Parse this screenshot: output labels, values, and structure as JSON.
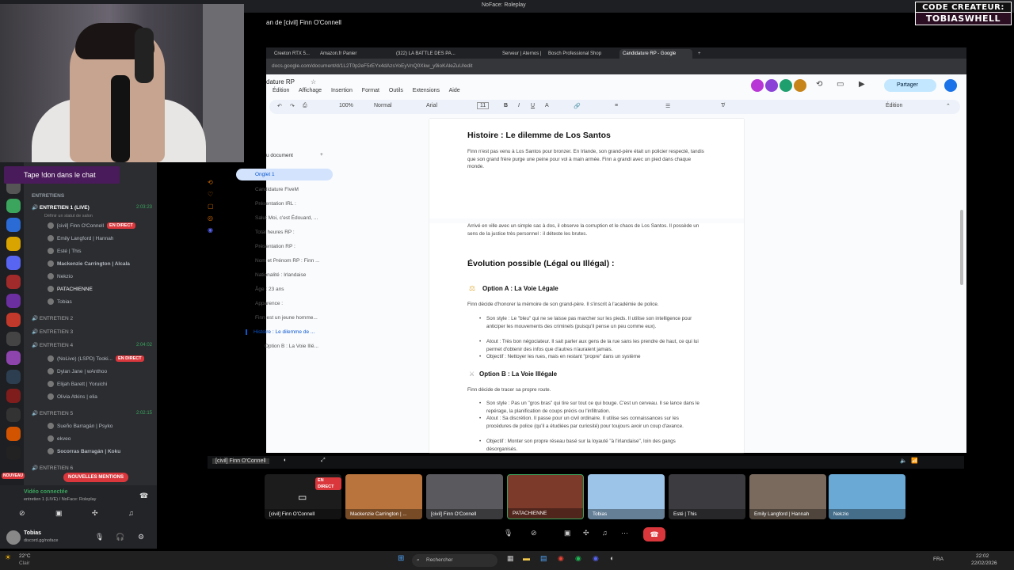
{
  "window": {
    "title": "NoFace: Roleplay"
  },
  "stream": {
    "title": "an de [civil] Finn O'Connell"
  },
  "badge": {
    "line1": "CODE CREATEUR:",
    "line2": "TOBIASWHELL"
  },
  "chat_banner": "Tape !don dans le chat",
  "channels": {
    "category": "ENTRETIENS",
    "live_label": "EN DIRECT",
    "items": [
      {
        "name": "ENTRETIEN 1 (LIVE)",
        "status": "Définir un statut de salon",
        "timer": "2:03:23",
        "users": [
          "[civil] Finn O'Connell",
          "Emily Langford | Hannah",
          "Esté | This",
          "Mackenzie Carrington | Alcala",
          "Nekzio",
          "PATACHIENNE",
          "Tobias"
        ]
      },
      {
        "name": "ENTRETIEN 2"
      },
      {
        "name": "ENTRETIEN 3"
      },
      {
        "name": "ENTRETIEN 4",
        "timer": "2:04:02",
        "users": [
          "(NoLive) (LSPD) Tooki...",
          "Dylan Jane | wAnthoo",
          "Elijah Barett | Yoruichi",
          "Olivia Atkins | elia"
        ]
      },
      {
        "name": "ENTRETIEN 5",
        "timer": "2:02:15",
        "users": [
          "Sueño Barragán | Psyko",
          "ekveo",
          "Socorras Barragán | Koku"
        ]
      },
      {
        "name": "ENTRETIEN 6"
      }
    ],
    "mentions_badge": "NOUVELLES MENTIONS",
    "new_badge": "NOUVEAU"
  },
  "voice_panel": {
    "status": "Vidéo connectée",
    "channel": "entretien 1 (LIVE) / NoFace: Roleplay"
  },
  "user_panel": {
    "name": "Tobias",
    "sub": "discord.gg/noface"
  },
  "browser": {
    "tabs": [
      "Creeton RTX 5...",
      "Amazon.fr Panier",
      "(322) LA BATTLE DES PA...",
      "Serveur | Aternos | Serve...",
      "Bosch Professional Shop",
      "Candidature RP - Google"
    ],
    "url": "docs.google.com/document/d/1L2T0p2eF5rEYx4dAzsYoEyVnQ0Xkw_y9ioKAleZuU/edit"
  },
  "docs": {
    "title": "dature RP",
    "menu": [
      "Édition",
      "Affichage",
      "Insertion",
      "Format",
      "Outils",
      "Extensions",
      "Aide"
    ],
    "share": "Partager",
    "mode": "Édition",
    "toolbar": {
      "zoom": "100%",
      "style": "Normal",
      "font": "Arial",
      "size": "11"
    }
  },
  "outline": {
    "header": "u document",
    "tab": "Onglet 1",
    "items": [
      "Candidature FiveM",
      "Présentation IRL :",
      "Salut Moi, c'est Édouard, ...",
      "Total heures RP :",
      "Présentation RP :",
      "Nom et Prénom RP : Finn ...",
      "Nationalité : Irlandaise",
      "Âge : 23 ans",
      "Apparence :",
      "Finn est un jeune homme...",
      "Histoire : Le dilemme de ...",
      "Option B : La Voie Illé..."
    ]
  },
  "document": {
    "h_history": "Histoire : Le dilemme de Los Santos",
    "p1": "Finn n'est pas venu à Los Santos pour bronzer. En Irlande, son grand-père était un policier respecté, tandis que son grand frère purge une peine pour vol à main armée. Finn a grandi avec un pied dans chaque monde.",
    "p2": "Arrivé en ville avec un simple sac à dos, il observe la corruption et le chaos de Los Santos. Il possède un sens de la justice très personnel : il déteste les brutes.",
    "h_evolution": "Évolution possible (Légal ou Illégal) :",
    "h_option_a": "Option A : La Voie Légale",
    "p_a": "Finn décide d'honorer la mémoire de son grand-père. Il s'inscrit à l'académie de police.",
    "a_items": [
      "Son style : Le \"bleu\" qui ne se laisse pas marcher sur les pieds. Il utilise son intelligence pour anticiper les mouvements des criminels (puisqu'il pense un peu comme eux).",
      "Atout : Très bon négociateur. Il sait parler aux gens de la rue sans les prendre de haut, ce qui lui permet d'obtenir des infos que d'autres n'auraient jamais.",
      "Objectif : Nettoyer les rues, mais en restant \"propre\" dans un système"
    ],
    "h_option_b": "Option B : La Voie Illégale",
    "p_b": "Finn décide de tracer sa propre route.",
    "b_items": [
      "Son style : Pas un \"gros bras\" qui tire sur tout ce qui bouge. C'est un cerveau. Il se lance dans le repérage, la planification de coups précis ou l'infiltration.",
      "Atout : Sa discrétion. Il passe pour un civil ordinaire. Il utilise ses connaissances sur les procédures de police (qu'il a étudiées par curiosité) pour toujours avoir un coup d'avance.",
      "Objectif : Monter son propre réseau basé sur la loyauté \"à l'irlandaise\", loin des gangs désorganisés."
    ]
  },
  "stream_controls": {
    "label": "[civil] Finn O'Connell"
  },
  "participants": [
    {
      "name": "[civil] Finn O'Connell",
      "live": "EN DIRECT",
      "color": "#1c1c1c"
    },
    {
      "name": "Mackenzie Carrington | ...",
      "color": "#b8743c"
    },
    {
      "name": "[civil] Finn O'Connell",
      "color": "#5a5a5e"
    },
    {
      "name": "PATACHIENNE",
      "color": "#7b3a2a"
    },
    {
      "name": "Tobias",
      "color": "#9cc4e8"
    },
    {
      "name": "Esté | This",
      "color": "#3c3c40"
    },
    {
      "name": "Emily Langford | Hannah",
      "color": "#7a6a5e"
    },
    {
      "name": "Nekzio",
      "color": "#6aa9d6"
    }
  ],
  "taskbar": {
    "weather_temp": "22°C",
    "weather_desc": "Clair",
    "search": "Rechercher",
    "lang": "FRA",
    "time": "22:02",
    "date": "22/02/2026"
  }
}
